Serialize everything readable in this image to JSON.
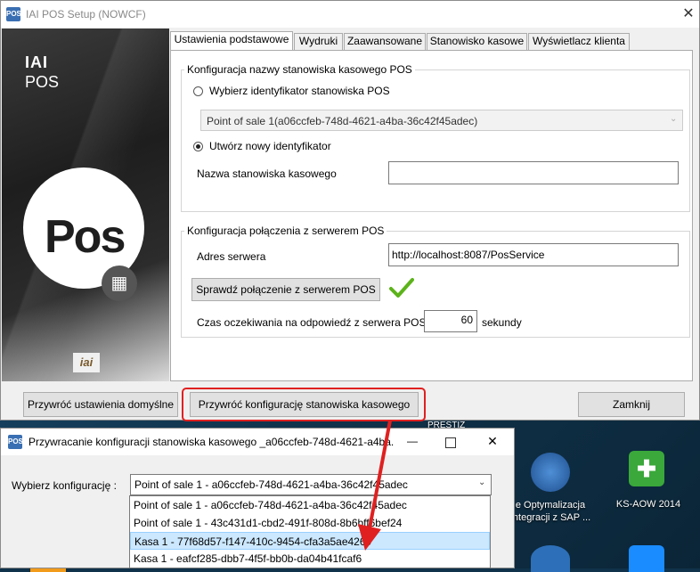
{
  "main_window": {
    "title": "IAI POS Setup (NOWCF)",
    "close": "✕",
    "brand": {
      "line1": "IAI",
      "line2": "POS",
      "logo_text": "Pos",
      "calc_icon": "calculator-icon",
      "small_logo": "iai"
    },
    "tabs": [
      "Ustawienia podstawowe",
      "Wydruki",
      "Zaawansowane",
      "Stanowisko kasowe",
      "Wyświetlacz klienta"
    ],
    "group1": {
      "title": "Konfiguracja nazwy stanowiska kasowego POS",
      "radio_existing": "Wybierz identyfikator stanowiska POS",
      "existing_value": "Point of sale 1(a06ccfeb-748d-4621-a4ba-36c42f45adec)",
      "radio_new": "Utwórz nowy identyfikator",
      "name_label": "Nazwa stanowiska kasowego",
      "name_value": ""
    },
    "group2": {
      "title": "Konfiguracja połączenia z serwerem POS",
      "address_label": "Adres serwera",
      "address_value": "http://localhost:8087/PosService",
      "check_button": "Sprawdź połączenie z serwerem POS",
      "timeout_label": "Czas oczekiwania na odpowiedź z serwera POS",
      "timeout_value": "60",
      "timeout_unit": "sekundy"
    },
    "buttons": {
      "restore_defaults": "Przywróć ustawienia domyślne",
      "restore_config": "Przywróć konfigurację stanowiska kasowego",
      "close": "Zamknij"
    }
  },
  "dialog": {
    "title": "Przywracanie konfiguracji stanowiska kasowego _a06ccfeb-748d-4621-a4ba...",
    "label": "Wybierz konfigurację   :",
    "selected": "Point of sale 1 - a06ccfeb-748d-4621-a4ba-36c42f45adec",
    "options": [
      "Point of sale 1 - a06ccfeb-748d-4621-a4ba-36c42f45adec",
      "Point of sale 1 - 43c431d1-cbd2-491f-808d-8b6bff6bef24",
      "Kasa 1 - 77f68d57-f147-410c-9454-cfa3a5ae4269",
      "Kasa 1 - eafcf285-dbb7-4f5f-bb0b-da04b41fcaf6"
    ],
    "highlighted_index": 2
  },
  "desktop": {
    "icon1_label": "e Optymalizacja\nIntegracji z SAP ...",
    "icon2_label": "KS-AOW 2014",
    "partial_label": "PRESTIŻ"
  },
  "colors": {
    "highlight_red": "#e02020",
    "check_green": "#5cb31a",
    "selection": "#cce8ff"
  }
}
